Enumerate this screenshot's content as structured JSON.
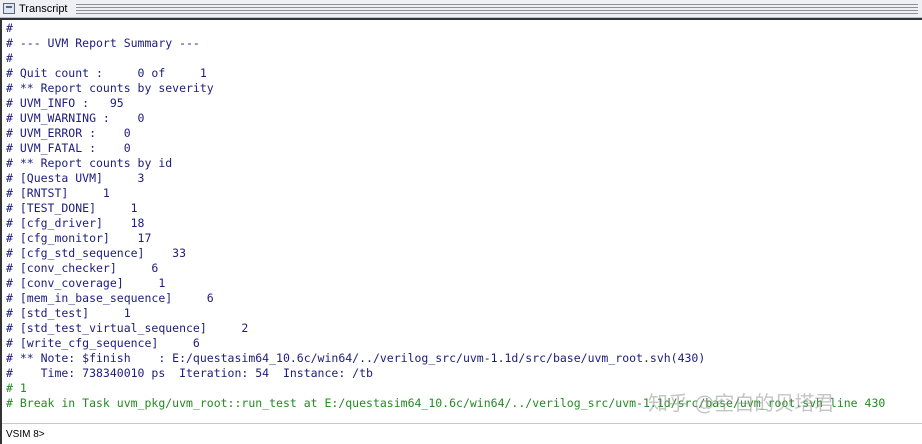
{
  "window": {
    "title": "Transcript"
  },
  "colors": {
    "text_default": "#1c1c7e",
    "text_green": "#238a23",
    "titlebar_bg": "#eef0f4"
  },
  "transcript": {
    "lines": [
      {
        "text": "#",
        "color": "default"
      },
      {
        "text": "# --- UVM Report Summary ---",
        "color": "default"
      },
      {
        "text": "#",
        "color": "default"
      },
      {
        "text": "# Quit count :     0 of     1",
        "color": "default"
      },
      {
        "text": "# ** Report counts by severity",
        "color": "default"
      },
      {
        "text": "# UVM_INFO :   95",
        "color": "default"
      },
      {
        "text": "# UVM_WARNING :    0",
        "color": "default"
      },
      {
        "text": "# UVM_ERROR :    0",
        "color": "default"
      },
      {
        "text": "# UVM_FATAL :    0",
        "color": "default"
      },
      {
        "text": "# ** Report counts by id",
        "color": "default"
      },
      {
        "text": "# [Questa UVM]     3",
        "color": "default"
      },
      {
        "text": "# [RNTST]     1",
        "color": "default"
      },
      {
        "text": "# [TEST_DONE]     1",
        "color": "default"
      },
      {
        "text": "# [cfg_driver]    18",
        "color": "default"
      },
      {
        "text": "# [cfg_monitor]    17",
        "color": "default"
      },
      {
        "text": "# [cfg_std_sequence]    33",
        "color": "default"
      },
      {
        "text": "# [conv_checker]     6",
        "color": "default"
      },
      {
        "text": "# [conv_coverage]     1",
        "color": "default"
      },
      {
        "text": "# [mem_in_base_sequence]     6",
        "color": "default"
      },
      {
        "text": "# [std_test]     1",
        "color": "default"
      },
      {
        "text": "# [std_test_virtual_sequence]     2",
        "color": "default"
      },
      {
        "text": "# [write_cfg_sequence]     6",
        "color": "default"
      },
      {
        "text": "# ** Note: $finish    : E:/questasim64_10.6c/win64/../verilog_src/uvm-1.1d/src/base/uvm_root.svh(430)",
        "color": "default"
      },
      {
        "text": "#    Time: 738340010 ps  Iteration: 54  Instance: /tb",
        "color": "default"
      },
      {
        "text": "# 1",
        "color": "green"
      },
      {
        "text": "# Break in Task uvm_pkg/uvm_root::run_test at E:/questasim64_10.6c/win64/../verilog_src/uvm-1.1d/src/base/uvm_root.svh line 430",
        "color": "green"
      }
    ]
  },
  "prompt": {
    "text": "VSIM 8>"
  },
  "watermark": {
    "text": "知乎 @空白的贝塔君"
  }
}
